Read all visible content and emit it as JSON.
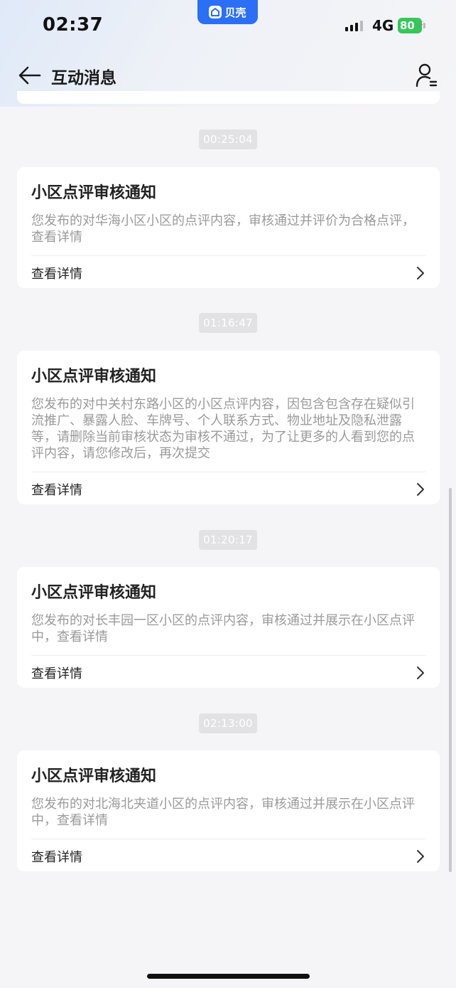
{
  "status_bar": {
    "time": "02:37",
    "app_name": "贝壳",
    "network": "4G",
    "battery": "80",
    "battery_color": "#34c759"
  },
  "header": {
    "title": "互动消息",
    "back_icon": "arrow-left-icon",
    "profile_icon": "user-list-icon"
  },
  "messages": [
    {
      "time": "00:25:04",
      "title": "小区点评审核通知",
      "body": "您发布的对华海小区小区的点评内容，审核通过并评价为合格点评，查看详情",
      "link": "查看详情"
    },
    {
      "time": "01:16:47",
      "title": "小区点评审核通知",
      "body": "您发布的对中关村东路小区的小区点评内容，因包含包含存在疑似引流推广、暴露人脸、车牌号、个人联系方式、物业地址及隐私泄露等，请删除当前审核状态为审核不通过，为了让更多的人看到您的点评内容，请您修改后，再次提交",
      "link": "查看详情"
    },
    {
      "time": "01:20:17",
      "title": "小区点评审核通知",
      "body": "您发布的对长丰园一区小区的点评内容，审核通过并展示在小区点评中，查看详情",
      "link": "查看详情"
    },
    {
      "time": "02:13:00",
      "title": "小区点评审核通知",
      "body": "您发布的对北海北夹道小区的点评内容，审核通过并展示在小区点评中，查看详情",
      "link": "查看详情"
    }
  ],
  "colors": {
    "accent": "#2b6ff5",
    "page_background": "#f5f5f7",
    "body_text": "#9a9a9a"
  }
}
